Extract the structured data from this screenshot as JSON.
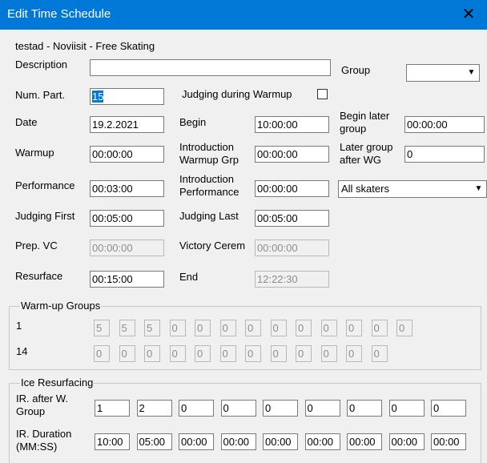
{
  "window": {
    "title": "Edit Time Schedule",
    "close_glyph": "✕"
  },
  "subtitle": "testad - Noviisit - Free Skating",
  "fields": {
    "description_label": "Description",
    "description_value": "",
    "group_label": "Group",
    "group_value": "",
    "num_part_label": "Num. Part.",
    "num_part_value": "15",
    "judging_warmup_label": "Judging during Warmup",
    "date_label": "Date",
    "date_value": "19.2.2021",
    "begin_label": "Begin",
    "begin_value": "10:00:00",
    "begin_later_label_1": "Begin later",
    "begin_later_label_2": "group",
    "begin_later_value": "00:00:00",
    "warmup_label": "Warmup",
    "warmup_value": "00:00:00",
    "intro_warmup_label_1": "Introduction",
    "intro_warmup_label_2": "Warmup Grp",
    "intro_warmup_value": "00:00:00",
    "later_group_label_1": "Later group",
    "later_group_label_2": "after WG",
    "later_group_value": "0",
    "performance_label": "Performance",
    "performance_value": "00:03:00",
    "intro_perf_label_1": "Introduction",
    "intro_perf_label_2": "Performance",
    "intro_perf_value": "00:00:00",
    "skaters_value": "All skaters",
    "judging_first_label": "Judging First",
    "judging_first_value": "00:05:00",
    "judging_last_label": "Judging Last",
    "judging_last_value": "00:05:00",
    "prep_vc_label": "Prep. VC",
    "prep_vc_value": "00:00:00",
    "victory_label": "Victory Cerem",
    "victory_value": "00:00:00",
    "resurface_label": "Resurface",
    "resurface_value": "00:15:00",
    "end_label": "End",
    "end_value": "12:22:30"
  },
  "warmup_groups": {
    "legend": "Warm-up Groups",
    "row1_label": "1",
    "row1_values": [
      "5",
      "5",
      "5",
      "0",
      "0",
      "0",
      "0",
      "0",
      "0",
      "0",
      "0",
      "0",
      "0"
    ],
    "row2_label": "14",
    "row2_values": [
      "0",
      "0",
      "0",
      "0",
      "0",
      "0",
      "0",
      "0",
      "0",
      "0",
      "0",
      "0"
    ]
  },
  "ice_resurfacing": {
    "legend": "Ice Resurfacing",
    "after_label_1": "IR. after W.",
    "after_label_2": "Group",
    "after_values": [
      "1",
      "2",
      "0",
      "0",
      "0",
      "0",
      "0",
      "0",
      "0"
    ],
    "duration_label_1": "IR. Duration",
    "duration_label_2": "(MM:SS)",
    "duration_values": [
      "10:00",
      "05:00",
      "00:00",
      "00:00",
      "00:00",
      "00:00",
      "00:00",
      "00:00",
      "00:00"
    ]
  }
}
